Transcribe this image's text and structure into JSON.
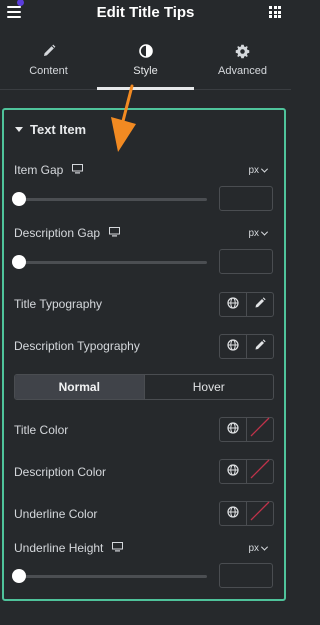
{
  "header": {
    "title": "Edit Title Tips"
  },
  "tabs": [
    {
      "label": "Content",
      "icon": "pencil-icon"
    },
    {
      "label": "Style",
      "icon": "contrast-icon",
      "active": true
    },
    {
      "label": "Advanced",
      "icon": "gear-icon"
    }
  ],
  "section": {
    "title": "Text Item"
  },
  "controls": {
    "item_gap": {
      "label": "Item Gap",
      "unit": "px",
      "value": ""
    },
    "description_gap": {
      "label": "Description Gap",
      "unit": "px",
      "value": ""
    },
    "title_typography": {
      "label": "Title Typography"
    },
    "description_typography": {
      "label": "Description Typography"
    },
    "state_toggle": {
      "options": [
        "Normal",
        "Hover"
      ],
      "selected": "Normal"
    },
    "title_color": {
      "label": "Title Color"
    },
    "description_color": {
      "label": "Description Color"
    },
    "underline_color": {
      "label": "Underline Color"
    },
    "underline_height": {
      "label": "Underline Height",
      "unit": "px",
      "value": ""
    }
  },
  "colors": {
    "panel_border": "#4fc39b",
    "arrow": "#f28a22",
    "no_color_slash": "#c0334a",
    "background": "#26292c"
  }
}
